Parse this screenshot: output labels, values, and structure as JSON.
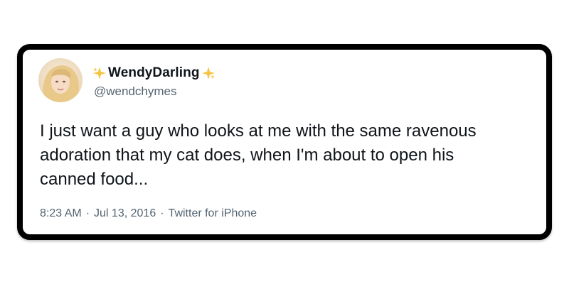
{
  "tweet": {
    "display_name": "WendyDarling",
    "handle": "@wendchymes",
    "text_lines": [
      "I just want a guy who looks at me with the same ravenous",
      "adoration that my cat does, when I'm about to open his",
      "canned food..."
    ],
    "time": "8:23 AM",
    "date": "Jul 13, 2016",
    "source": "Twitter for iPhone",
    "separator": "·"
  },
  "icons": {
    "left_decoration": "sparkles-icon",
    "right_decoration": "sparkles-icon"
  },
  "colors": {
    "text_primary": "#0f1419",
    "text_secondary": "#536471",
    "sparkle": "#f5c542",
    "border": "#000000"
  }
}
